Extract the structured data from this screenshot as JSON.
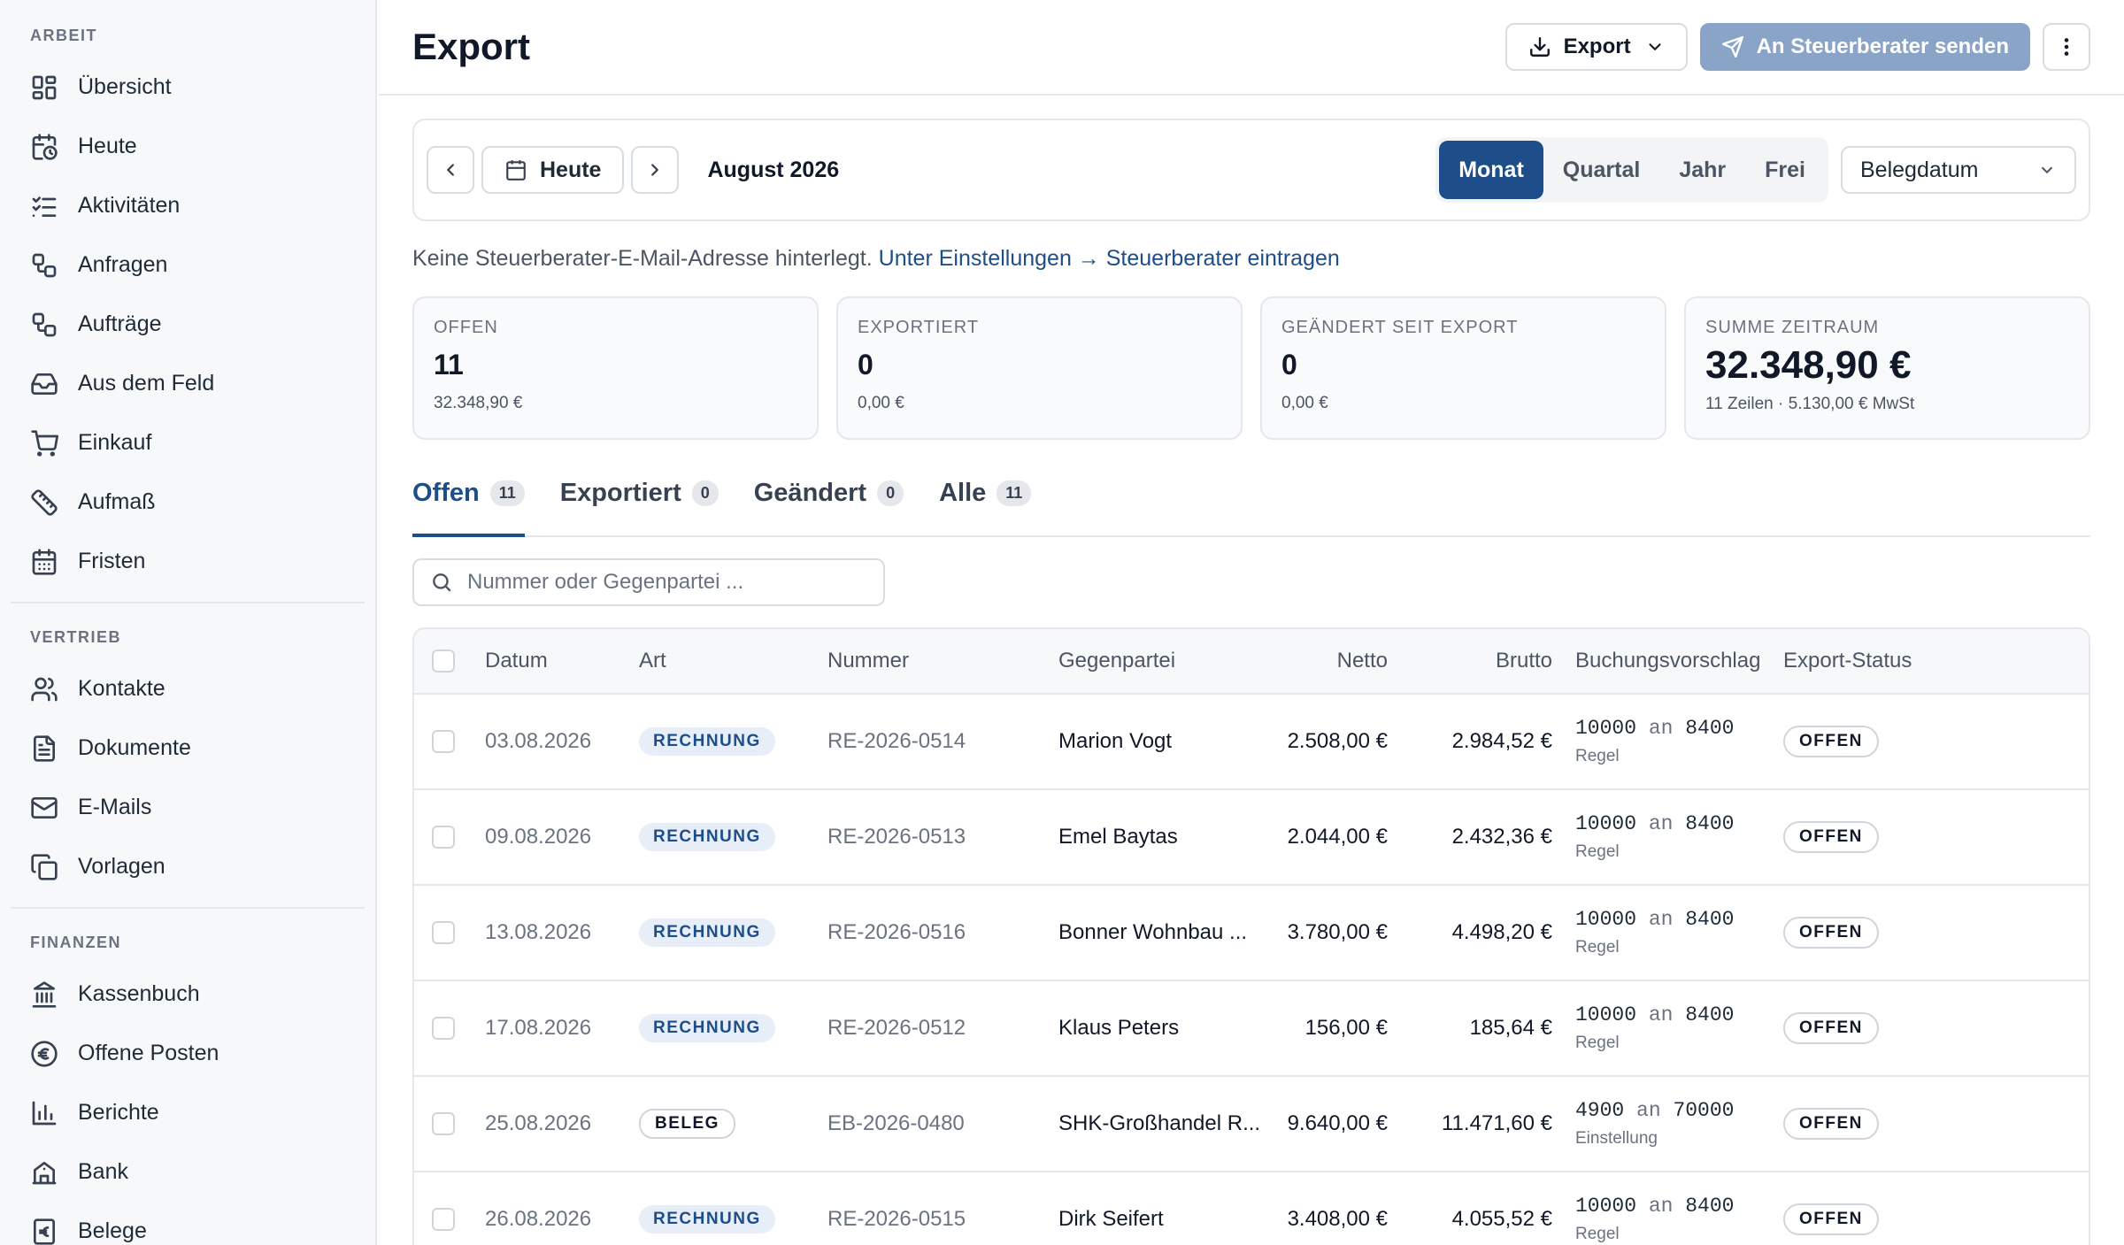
{
  "sidebar": {
    "sections": [
      {
        "heading": "ARBEIT",
        "items": [
          {
            "label": "Übersicht",
            "icon": "dashboard-icon"
          },
          {
            "label": "Heute",
            "icon": "calendar-clock-icon"
          },
          {
            "label": "Aktivitäten",
            "icon": "list-check-icon"
          },
          {
            "label": "Anfragen",
            "icon": "workflow-icon"
          },
          {
            "label": "Aufträge",
            "icon": "workflow-icon"
          },
          {
            "label": "Aus dem Feld",
            "icon": "inbox-icon"
          },
          {
            "label": "Einkauf",
            "icon": "cart-icon"
          },
          {
            "label": "Aufmaß",
            "icon": "ruler-icon"
          },
          {
            "label": "Fristen",
            "icon": "calendar-icon"
          }
        ]
      },
      {
        "heading": "VERTRIEB",
        "items": [
          {
            "label": "Kontakte",
            "icon": "users-icon"
          },
          {
            "label": "Dokumente",
            "icon": "document-icon"
          },
          {
            "label": "E-Mails",
            "icon": "mail-icon"
          },
          {
            "label": "Vorlagen",
            "icon": "copy-icon"
          }
        ]
      },
      {
        "heading": "FINANZEN",
        "items": [
          {
            "label": "Kassenbuch",
            "icon": "bank-icon"
          },
          {
            "label": "Offene Posten",
            "icon": "euro-icon"
          },
          {
            "label": "Berichte",
            "icon": "bar-chart-icon"
          },
          {
            "label": "Bank",
            "icon": "bank-building-icon"
          },
          {
            "label": "Belege",
            "icon": "receipt-euro-icon"
          }
        ]
      }
    ]
  },
  "header": {
    "title": "Export",
    "export_label": "Export",
    "send_label": "An Steuerberater senden"
  },
  "filter": {
    "today_label": "Heute",
    "period": "August 2026",
    "segments": [
      "Monat",
      "Quartal",
      "Jahr",
      "Frei"
    ],
    "active_segment": "Monat",
    "date_field": "Belegdatum"
  },
  "notice": {
    "text": "Keine Steuerberater-E-Mail-Adresse hinterlegt.",
    "link": "Unter Einstellungen → Steuerberater eintragen"
  },
  "cards": [
    {
      "label": "OFFEN",
      "value": "11",
      "sub": "32.348,90 €"
    },
    {
      "label": "EXPORTIERT",
      "value": "0",
      "sub": "0,00 €"
    },
    {
      "label": "GEÄNDERT SEIT EXPORT",
      "value": "0",
      "sub": "0,00 €"
    },
    {
      "label": "SUMME ZEITRAUM",
      "value": "32.348,90 €",
      "sub": "11 Zeilen · 5.130,00 € MwSt"
    }
  ],
  "tabs": [
    {
      "label": "Offen",
      "count": "11"
    },
    {
      "label": "Exportiert",
      "count": "0"
    },
    {
      "label": "Geändert",
      "count": "0"
    },
    {
      "label": "Alle",
      "count": "11"
    }
  ],
  "search": {
    "placeholder": "Nummer oder Gegenpartei ..."
  },
  "table": {
    "headers": {
      "datum": "Datum",
      "art": "Art",
      "nummer": "Nummer",
      "gegenpartei": "Gegenpartei",
      "netto": "Netto",
      "brutto": "Brutto",
      "buchung": "Buchungsvorschlag",
      "status": "Export-Status"
    },
    "rows": [
      {
        "datum": "03.08.2026",
        "art": "RECHNUNG",
        "nummer": "RE-2026-0514",
        "gegenpartei": "Marion Vogt",
        "netto": "2.508,00 €",
        "brutto": "2.984,52 €",
        "soll": "10000",
        "an": "an",
        "haben": "8400",
        "quelle": "Regel",
        "status": "OFFEN"
      },
      {
        "datum": "09.08.2026",
        "art": "RECHNUNG",
        "nummer": "RE-2026-0513",
        "gegenpartei": "Emel Baytas",
        "netto": "2.044,00 €",
        "brutto": "2.432,36 €",
        "soll": "10000",
        "an": "an",
        "haben": "8400",
        "quelle": "Regel",
        "status": "OFFEN"
      },
      {
        "datum": "13.08.2026",
        "art": "RECHNUNG",
        "nummer": "RE-2026-0516",
        "gegenpartei": "Bonner Wohnbau ...",
        "netto": "3.780,00 €",
        "brutto": "4.498,20 €",
        "soll": "10000",
        "an": "an",
        "haben": "8400",
        "quelle": "Regel",
        "status": "OFFEN"
      },
      {
        "datum": "17.08.2026",
        "art": "RECHNUNG",
        "nummer": "RE-2026-0512",
        "gegenpartei": "Klaus Peters",
        "netto": "156,00 €",
        "brutto": "185,64 €",
        "soll": "10000",
        "an": "an",
        "haben": "8400",
        "quelle": "Regel",
        "status": "OFFEN"
      },
      {
        "datum": "25.08.2026",
        "art": "BELEG",
        "nummer": "EB-2026-0480",
        "gegenpartei": "SHK-Großhandel R...",
        "netto": "9.640,00 €",
        "brutto": "11.471,60 €",
        "soll": "4900",
        "an": "an",
        "haben": "70000",
        "quelle": "Einstellung",
        "status": "OFFEN"
      },
      {
        "datum": "26.08.2026",
        "art": "RECHNUNG",
        "nummer": "RE-2026-0515",
        "gegenpartei": "Dirk Seifert",
        "netto": "3.408,00 €",
        "brutto": "4.055,52 €",
        "soll": "10000",
        "an": "an",
        "haben": "8400",
        "quelle": "Regel",
        "status": "OFFEN"
      }
    ]
  },
  "colors": {
    "accent": "#1d4e89",
    "primary_disabled": "#8aa4c8",
    "badge_bg": "#e8eef8"
  }
}
